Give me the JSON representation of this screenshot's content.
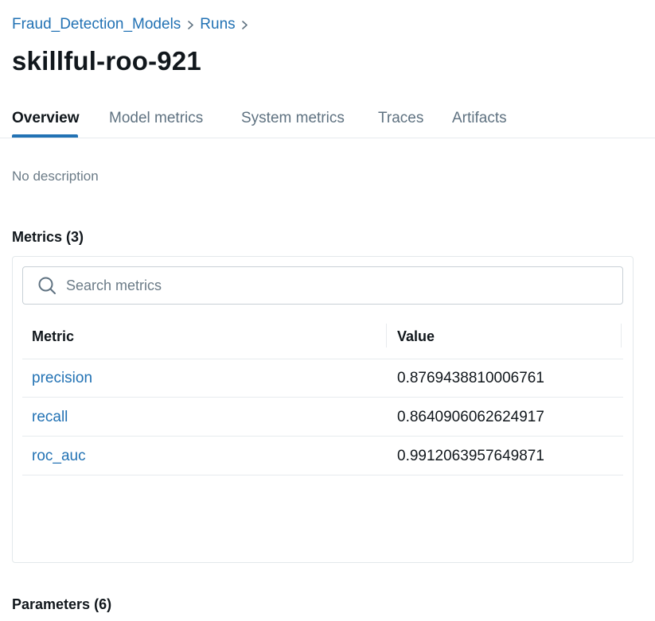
{
  "breadcrumb": {
    "experiment": "Fraud_Detection_Models",
    "runs": "Runs"
  },
  "run": {
    "title": "skillful-roo-921"
  },
  "tabs": [
    {
      "label": "Overview",
      "active": true
    },
    {
      "label": "Model metrics",
      "active": false
    },
    {
      "label": "System metrics",
      "active": false
    },
    {
      "label": "Traces",
      "active": false
    },
    {
      "label": "Artifacts",
      "active": false
    }
  ],
  "description": "No description",
  "metrics": {
    "heading": "Metrics (3)",
    "search_placeholder": "Search metrics",
    "columns": {
      "metric": "Metric",
      "value": "Value"
    },
    "rows": [
      {
        "name": "precision",
        "value": "0.8769438810006761"
      },
      {
        "name": "recall",
        "value": "0.8640906062624917"
      },
      {
        "name": "roc_auc",
        "value": "0.9912063957649871"
      }
    ]
  },
  "parameters": {
    "heading": "Parameters (6)"
  },
  "colors": {
    "link": "#2272b4",
    "active_tab_underline": "#2272b4",
    "muted_text": "#5f7281"
  },
  "icons": {
    "breadcrumb_separator": "chevron-right-icon",
    "search": "search-icon"
  }
}
